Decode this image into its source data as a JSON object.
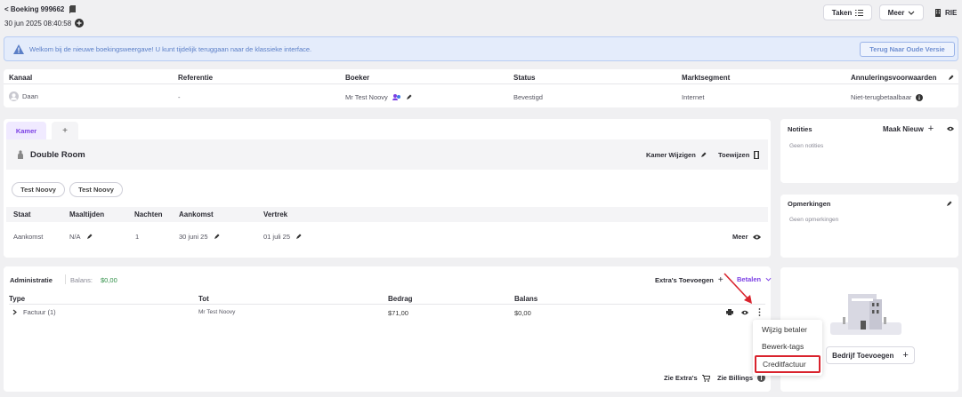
{
  "header": {
    "back_label": "< Boeking 999662",
    "date": "30 jun 2025 08:40:58",
    "taken_label": "Taken",
    "meer_label": "Meer",
    "rie_label": "RIE"
  },
  "banner": {
    "text": "Welkom bij de nieuwe boekingsweergave! U kunt tijdelijk teruggaan naar de klassieke interface.",
    "button_label": "Terug Naar Oude Versie"
  },
  "info": {
    "headers": [
      "Kanaal",
      "Referentie",
      "Boeker",
      "Status",
      "Marktsegment",
      "Annuleringsvoorwaarden"
    ],
    "values": [
      "Daan",
      "-",
      "Mr Test Noovy",
      "Bevestigd",
      "Internet",
      "Niet-terugbetaalbaar"
    ]
  },
  "room": {
    "tab_label": "Kamer",
    "tab_add": "+",
    "name": "Double Room",
    "change_label": "Kamer Wijzigen",
    "assign_label": "Toewijzen",
    "guests": [
      "Test Noovy",
      "Test Noovy"
    ],
    "headers": [
      "Staat",
      "Maaltijden",
      "Nachten",
      "Aankomst",
      "Vertrek"
    ],
    "values": [
      "Aankomst",
      "N/A",
      "1",
      "30 juni 25",
      "01 juli 25"
    ],
    "meer_label": "Meer"
  },
  "notes": {
    "title": "Notities",
    "new_label": "Maak Nieuw",
    "empty": "Geen notities"
  },
  "remarks": {
    "title": "Opmerkingen",
    "empty": "Geen opmerkingen"
  },
  "admin": {
    "title": "Administratie",
    "balance_label": "Balans:",
    "balance_value": "$0,00",
    "extras_label": "Extra's Toevoegen",
    "pay_label": "Betalen",
    "headers": [
      "Type",
      "Tot",
      "Bedrag",
      "Balans"
    ],
    "row": [
      "Factuur (1)",
      "Mr Test Noovy",
      "$71,00",
      "$0,00"
    ],
    "see_extras": "Zie Extra's",
    "see_billings": "Zie Billings"
  },
  "menu": {
    "items": [
      "Wijzig betaler",
      "Bewerk-tags",
      "Creditfactuur"
    ]
  },
  "company": {
    "add_label": "Bedrijf Toevoegen"
  },
  "colors": {
    "accent": "#7b3fe4",
    "banner_bg": "#e4ecfb",
    "highlight": "#d9232d"
  }
}
